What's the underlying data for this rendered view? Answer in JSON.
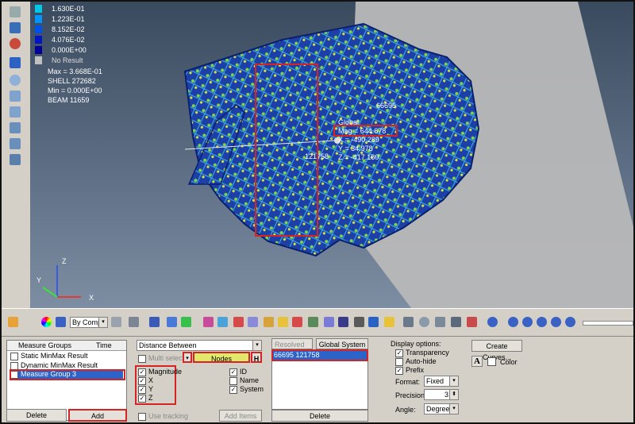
{
  "legend": {
    "entries": [
      {
        "value": "1.630E-01",
        "color": "#00c8e6"
      },
      {
        "value": "1.223E-01",
        "color": "#0096ff"
      },
      {
        "value": "8.152E-02",
        "color": "#0050e6"
      },
      {
        "value": "4.076E-02",
        "color": "#0014c8"
      },
      {
        "value": "0.000E+00",
        "color": "#000096"
      },
      {
        "value": "No Result",
        "color": "#c0c0c0"
      }
    ],
    "max_line": "Max = 3.668E-01",
    "shell_line": "SHELL 272682",
    "min_line": "Min = 0.000E+00",
    "beam_line": "BEAM 11659"
  },
  "probe": {
    "node_a": "66695",
    "node_b": "121758",
    "title": "Global",
    "mag": "Mag = 644.678",
    "x": "X = -490.289",
    "y": "Y = 34.978",
    "z": "Z = -417.160"
  },
  "axes": {
    "x": "X",
    "y": "Y",
    "z": "Z"
  },
  "toolbar": {
    "by_comp": "By Comp"
  },
  "measure_groups": {
    "col_groups": "Measure Groups",
    "col_time": "Time",
    "items": [
      {
        "label": "Static MinMax Result",
        "checked": false
      },
      {
        "label": "Dynamic MinMax Result",
        "checked": false
      },
      {
        "label": "Measure Group 3",
        "checked": true
      }
    ],
    "delete": "Delete",
    "add": "Add"
  },
  "distance": {
    "type": "Distance Between",
    "multi_select": "Multi select",
    "nodes": "Nodes",
    "h": "H",
    "options_left": [
      {
        "label": "Magnitude",
        "checked": true
      },
      {
        "label": "X",
        "checked": true
      },
      {
        "label": "Y",
        "checked": true
      },
      {
        "label": "Z",
        "checked": true
      }
    ],
    "options_right": [
      {
        "label": "ID",
        "checked": true
      },
      {
        "label": "Name",
        "checked": false
      },
      {
        "label": "System",
        "checked": true
      }
    ],
    "use_tracking": "Use tracking",
    "add_items": "Add Items"
  },
  "resolved": {
    "label": "Resolved in...",
    "system": "Global System",
    "item": "66695 121758",
    "delete": "Delete"
  },
  "display": {
    "title": "Display options:",
    "transparency": "Transparency",
    "auto_hide": "Auto-hide",
    "prefix": "Prefix",
    "format_label": "Format:",
    "format_value": "Fixed",
    "precision_label": "Precision:",
    "precision_value": "3",
    "angle_label": "Angle:",
    "angle_value": "Degrees",
    "create_curves": "Create Curves...",
    "font_glyph": "A",
    "color_label": "Color"
  }
}
